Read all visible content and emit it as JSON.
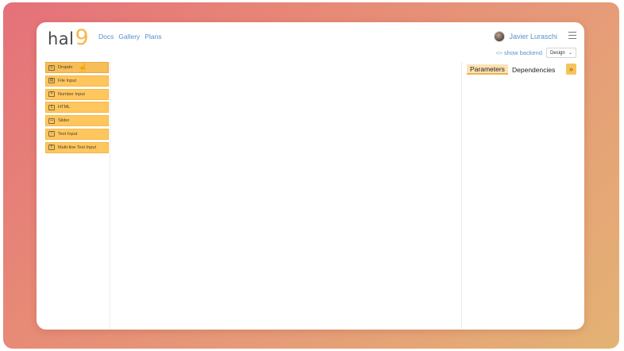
{
  "header": {
    "logo_text": "hal",
    "logo_nine": "9",
    "nav": [
      "Docs",
      "Gallery",
      "Plans"
    ],
    "user_name": "Javier Luraschi",
    "show_backend": "show backend",
    "mode": "Design"
  },
  "components": [
    {
      "label": "Dropdo",
      "icon": "dropdown-icon",
      "glyph": "≡"
    },
    {
      "label": "File Input",
      "icon": "file-icon",
      "glyph": "▤"
    },
    {
      "label": "Number Input",
      "icon": "number-icon",
      "glyph": "#"
    },
    {
      "label": "HTML",
      "icon": "html-icon",
      "glyph": "5"
    },
    {
      "label": "Slider",
      "icon": "slider-icon",
      "glyph": "⊸"
    },
    {
      "label": "Text Input",
      "icon": "text-input-icon",
      "glyph": "T"
    },
    {
      "label": "Multi-line Text Input",
      "icon": "textarea-icon",
      "glyph": "¶"
    }
  ],
  "right_panel": {
    "tabs": [
      "Parameters",
      "Dependencies"
    ]
  },
  "colors": {
    "accent": "#ffc65e",
    "link": "#5a8fcf"
  }
}
